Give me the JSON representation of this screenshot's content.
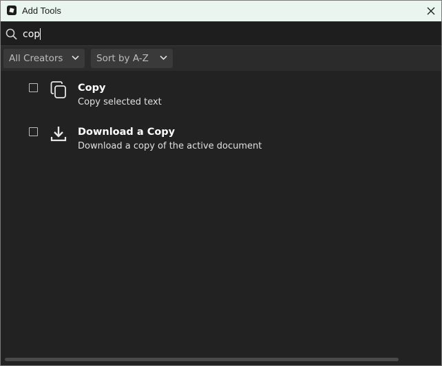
{
  "window": {
    "title": "Add Tools",
    "app_icon": "app-logo-icon",
    "close_icon": "close-icon"
  },
  "search": {
    "value": "cop",
    "icon": "search-icon"
  },
  "filters": {
    "creators": {
      "selected": "All Creators",
      "icon": "chevron-down-icon"
    },
    "sort": {
      "selected": "Sort by A-Z",
      "icon": "chevron-down-icon"
    }
  },
  "tools": [
    {
      "name": "Copy",
      "description": "Copy selected text",
      "icon": "copy-icon",
      "checked": false
    },
    {
      "name": "Download a Copy",
      "description": "Download a copy of the active document",
      "icon": "download-icon",
      "checked": false
    }
  ]
}
